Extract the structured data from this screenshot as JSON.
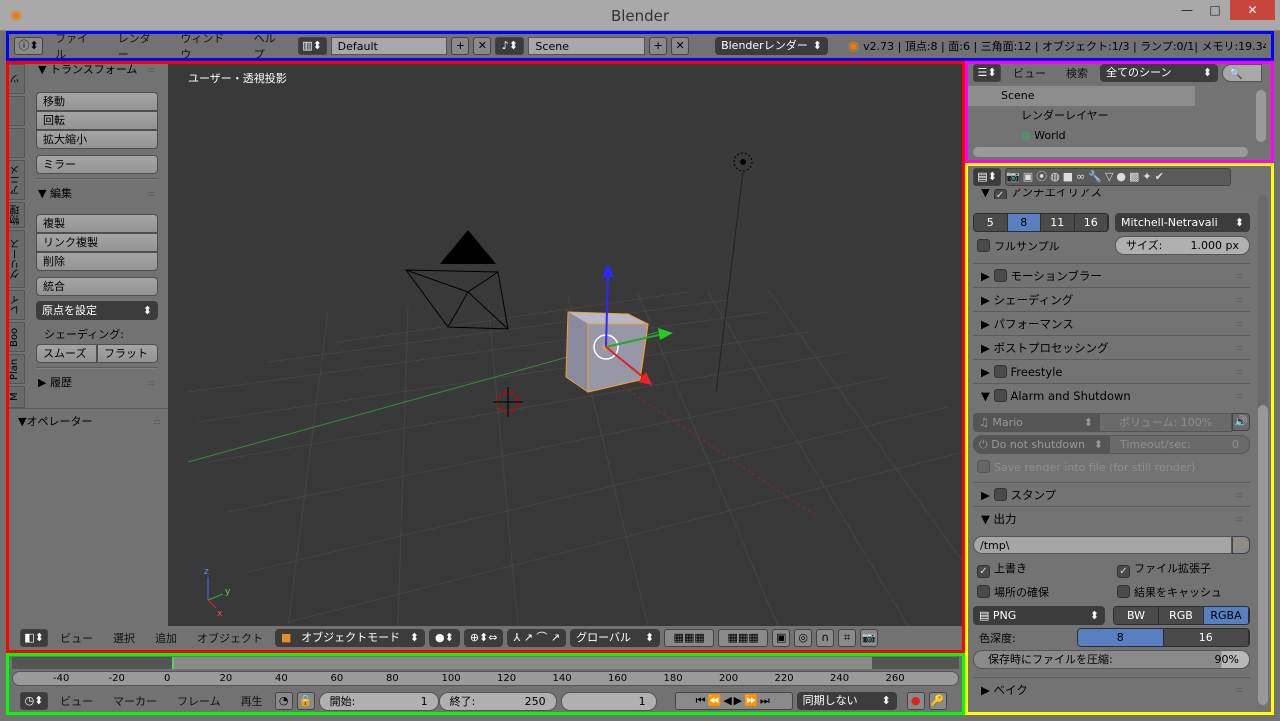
{
  "window": {
    "title": "Blender",
    "minimize": "—",
    "maximize": "□",
    "close": "✕"
  },
  "info_header": {
    "menus": [
      "ファイル",
      "レンダー",
      "ウィンドウ",
      "ヘルプ"
    ],
    "layout": "Default",
    "scene": "Scene",
    "engine": "Blenderレンダー",
    "stats": "v2.73 | 頂点:8 | 面:6 | 三角面:12 | オブジェクト:1/3 | ランプ:0/1| メモリ:19.34M"
  },
  "toolshelf": {
    "tabs": [
      "ツ",
      "",
      "",
      "アニメ",
      "物理",
      "グリース",
      "レイ",
      "Boo",
      "Plan",
      "M"
    ],
    "transform": {
      "title": "▼ トランスフォーム",
      "buttons": [
        "移動",
        "回転",
        "拡大縮小"
      ],
      "mirror": "ミラー"
    },
    "edit": {
      "title": "▼ 編集",
      "buttons": [
        "複製",
        "リンク複製",
        "削除"
      ],
      "join": "統合",
      "origin": "原点を設定",
      "shading_label": "シェーディング:",
      "smooth": "スムーズ",
      "flat": "フラット"
    },
    "history": "▶ 履歴",
    "operator": "▼オペレーター"
  },
  "viewport": {
    "label": "ユーザー・透視投影",
    "axis": {
      "x": "x",
      "y": "y",
      "z": "z"
    }
  },
  "view3d_header": {
    "menus": [
      "ビュー",
      "選択",
      "追加",
      "オブジェクト"
    ],
    "mode": "オブジェクトモード",
    "orientation": "グローバル"
  },
  "timeline": {
    "ticks": [
      "-40",
      "-20",
      "0",
      "20",
      "40",
      "60",
      "80",
      "100",
      "120",
      "140",
      "160",
      "180",
      "200",
      "220",
      "240",
      "260"
    ],
    "menus": [
      "ビュー",
      "マーカー",
      "フレーム",
      "再生"
    ],
    "start_label": "開始:",
    "start": "1",
    "end_label": "終了:",
    "end": "250",
    "current": "1",
    "sync": "同期しない"
  },
  "outliner": {
    "menus": [
      "ビュー",
      "検索"
    ],
    "filter": "全てのシーン",
    "items": [
      "Scene",
      "レンダーレイヤー",
      "World"
    ]
  },
  "properties": {
    "antialias": {
      "title": "アンチエイリアス",
      "samples": [
        "5",
        "8",
        "11",
        "16"
      ],
      "selected_sample": "8",
      "filter": "Mitchell-Netravali",
      "full_sample": "フルサンプル",
      "size_label": "サイズ:",
      "size": "1.000 px"
    },
    "panels": [
      "モーションブラー",
      "シェーディング",
      "パフォーマンス",
      "ポストプロセッシング",
      "Freestyle"
    ],
    "alarm": {
      "title": "Alarm and Shutdown",
      "sound": "Mario",
      "volume": "ボリューム: 100%",
      "shutdown": "Do not shutdown",
      "timeout_label": "Timeout/sec:",
      "timeout": "0",
      "save": "Save render into file (for still render)"
    },
    "stamp": "スタンプ",
    "output": {
      "title": "▼ 出力",
      "path": "/tmp\\",
      "overwrite": "上書き",
      "overwrite_checked": true,
      "extension": "ファイル拡張子",
      "extension_checked": true,
      "placeholders": "場所の確保",
      "cache": "結果をキャッシュ",
      "format": "PNG",
      "color_modes": [
        "BW",
        "RGB",
        "RGBA"
      ],
      "color_mode": "RGBA",
      "depth_label": "色深度:",
      "depths": [
        "8",
        "16"
      ],
      "depth": "8",
      "compress_label": "保存時にファイルを圧縮:",
      "compress": "90%",
      "compress_value": 90
    },
    "bake": "▶ ベイク"
  },
  "colors": {
    "info_outline": "#0000ff",
    "view3d_outline": "#ff0000",
    "timeline_outline": "#00ff00",
    "outliner_outline": "#ff00ff",
    "properties_outline": "#ffff00",
    "selected": "#5680c2",
    "viewport_bg": "#393939"
  }
}
